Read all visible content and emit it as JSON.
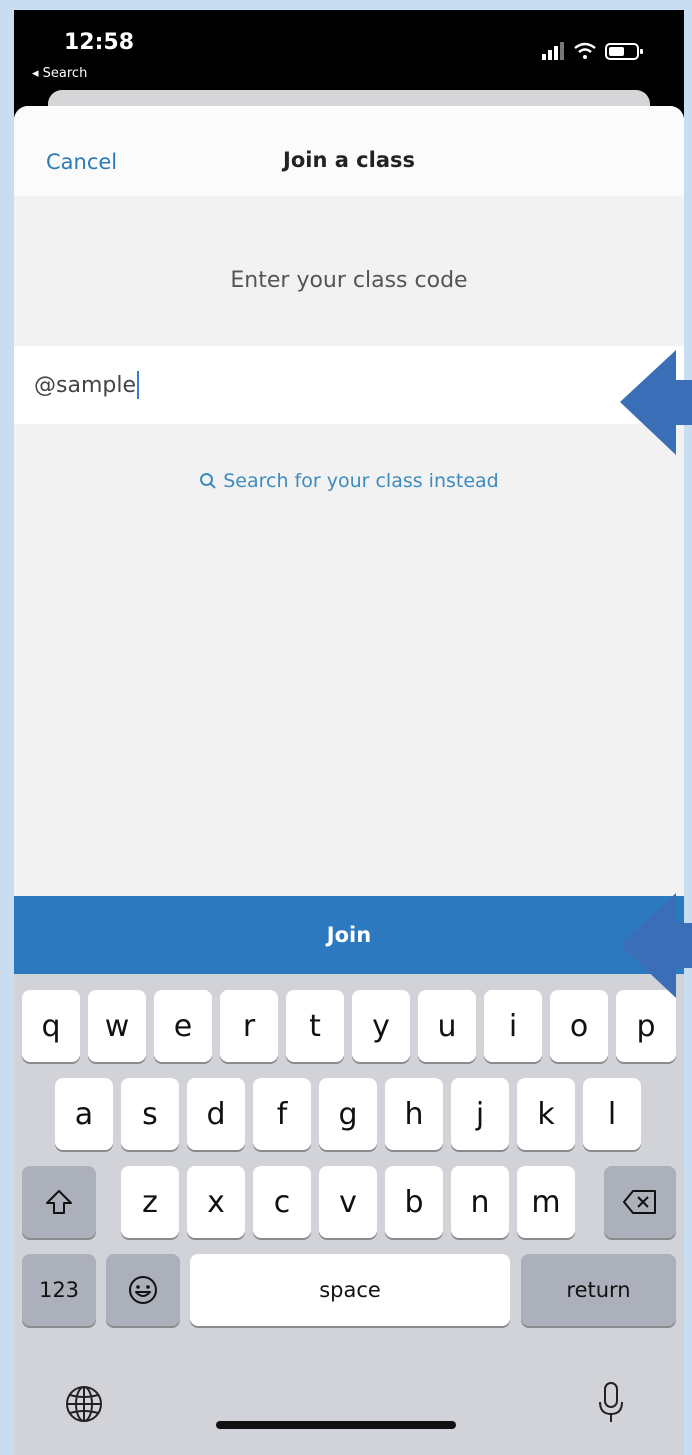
{
  "status": {
    "time": "12:58",
    "back_app": "◂ Search"
  },
  "nav": {
    "cancel": "Cancel",
    "title": "Join a class"
  },
  "prompt": "Enter your class code",
  "code_input": {
    "value": "@sample"
  },
  "search_link": "Search for your class instead",
  "join_button": "Join",
  "keyboard": {
    "row1": [
      "q",
      "w",
      "e",
      "r",
      "t",
      "y",
      "u",
      "i",
      "o",
      "p"
    ],
    "row2": [
      "a",
      "s",
      "d",
      "f",
      "g",
      "h",
      "j",
      "k",
      "l"
    ],
    "row3": [
      "z",
      "x",
      "c",
      "v",
      "b",
      "n",
      "m"
    ],
    "numbers": "123",
    "space": "space",
    "return": "return"
  },
  "colors": {
    "accent": "#2c79c0",
    "link": "#3d8bbd",
    "arrow": "#3a6fb8",
    "frame": "#c8ddf2"
  },
  "icons": [
    "signal-icon",
    "wifi-icon",
    "battery-icon",
    "search-icon",
    "shift-icon",
    "backspace-icon",
    "emoji-icon",
    "globe-icon",
    "microphone-icon"
  ]
}
